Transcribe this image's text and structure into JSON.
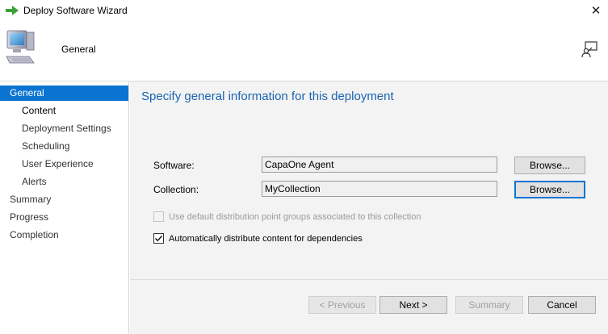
{
  "window": {
    "title": "Deploy Software Wizard",
    "close_glyph": "✕"
  },
  "header": {
    "title": "General"
  },
  "sidebar": {
    "items": [
      {
        "label": "General",
        "level": 0,
        "state": "active"
      },
      {
        "label": "Content",
        "level": 1,
        "state": "current"
      },
      {
        "label": "Deployment Settings",
        "level": 1,
        "state": "normal"
      },
      {
        "label": "Scheduling",
        "level": 1,
        "state": "normal"
      },
      {
        "label": "User Experience",
        "level": 1,
        "state": "normal"
      },
      {
        "label": "Alerts",
        "level": 1,
        "state": "normal"
      },
      {
        "label": "Summary",
        "level": 0,
        "state": "normal"
      },
      {
        "label": "Progress",
        "level": 0,
        "state": "normal"
      },
      {
        "label": "Completion",
        "level": 0,
        "state": "normal"
      }
    ]
  },
  "main": {
    "heading": "Specify general information for this deployment",
    "software": {
      "label": "Software:",
      "value": "CapaOne Agent",
      "browse_label": "Browse..."
    },
    "collection": {
      "label": "Collection:",
      "value": "MyCollection",
      "browse_label": "Browse..."
    },
    "options": {
      "use_default_dp": {
        "label": "Use default distribution point groups associated to this collection",
        "checked": false,
        "enabled": false
      },
      "auto_distribute": {
        "label": "Automatically distribute content for dependencies",
        "checked": true,
        "enabled": true
      }
    }
  },
  "footer": {
    "previous_label": "< Previous",
    "next_label": "Next >",
    "summary_label": "Summary",
    "cancel_label": "Cancel"
  },
  "colors": {
    "accent": "#0a74d0",
    "heading": "#1a63b0",
    "arrow": "#3aa335"
  },
  "icons": {
    "title": "green-arrow-icon",
    "header": "computer-icon",
    "help": "help-person-icon",
    "checkmark": "checkmark-icon"
  }
}
